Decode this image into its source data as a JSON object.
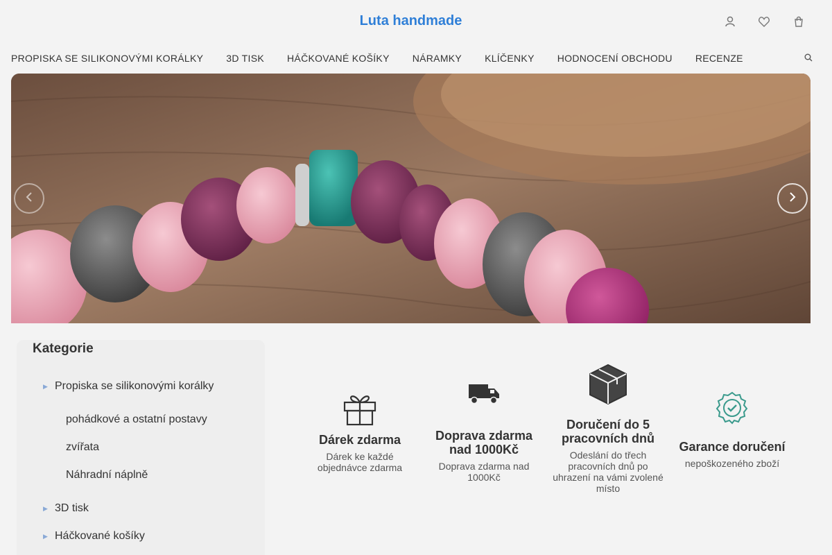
{
  "header": {
    "brand": "Luta handmade",
    "icons": [
      "user-icon",
      "heart-icon",
      "cart-icon"
    ]
  },
  "nav": {
    "items": [
      "PROPISKA SE SILIKONOVÝMI KORÁLKY",
      "3D TISK",
      "HÁČKOVANÉ KOŠÍKY",
      "NÁRAMKY",
      "KLÍČENKY",
      "HODNOCENÍ OBCHODU",
      "RECENZE"
    ],
    "search_icon": "search-icon"
  },
  "hero": {
    "prev_icon": "chevron-left-icon",
    "next_icon": "chevron-right-icon"
  },
  "categories": {
    "title": "Kategorie",
    "items": [
      {
        "label": "Propiska se silikonovými korálky"
      },
      {
        "label": "3D tisk"
      },
      {
        "label": "Háčkované košíky"
      }
    ],
    "subitems": [
      "pohádkové a ostatní postavy",
      "zvířata",
      "Náhradní náplně"
    ]
  },
  "features": [
    {
      "icon": "gift-icon",
      "title": "Dárek zdarma",
      "desc": "Dárek ke každé objednávce zdarma"
    },
    {
      "icon": "truck-icon",
      "title": "Doprava zdarma nad 1000Kč",
      "desc": "Doprava zdarma nad 1000Kč"
    },
    {
      "icon": "package-icon",
      "title": "Doručení do 5 pracovních dnů",
      "desc": "Odeslání do třech pracovních dnů po uhrazení na vámi zvolené místo"
    },
    {
      "icon": "verified-badge-icon",
      "title": "Garance doručení",
      "desc": "nepoškozeného zboží"
    }
  ],
  "colors": {
    "brand": "#2f7fd7",
    "background": "#f3f3f3",
    "sidebar": "#eeeeee"
  }
}
